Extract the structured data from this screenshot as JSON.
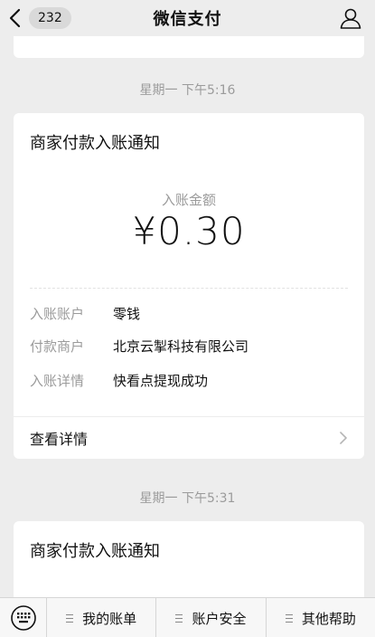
{
  "nav": {
    "badge": "232",
    "title": "微信支付"
  },
  "messages": [
    {
      "time": "星期一 下午5:16",
      "card_title": "商家付款入账通知",
      "amount_label": "入账金额",
      "amount": "¥0.30",
      "rows": [
        {
          "key": "入账账户",
          "value": "零钱"
        },
        {
          "key": "付款商户",
          "value": "北京云掣科技有限公司"
        },
        {
          "key": "入账详情",
          "value": "快看点提现成功"
        }
      ],
      "details_label": "查看详情"
    },
    {
      "time": "星期一 下午5:31",
      "card_title": "商家付款入账通知"
    }
  ],
  "bottom_menu": {
    "items": [
      "我的账单",
      "账户安全",
      "其他帮助"
    ]
  },
  "icons": {
    "back": "chevron-left-icon",
    "user": "user-icon",
    "keyboard": "keyboard-icon",
    "chevron": "chevron-right-icon",
    "menu": "menu-lines-icon"
  }
}
